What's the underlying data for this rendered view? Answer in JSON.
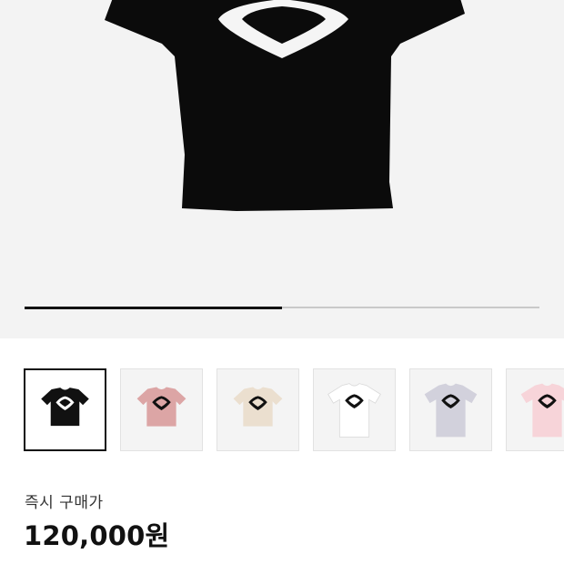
{
  "gallery": {
    "progress": 0.5,
    "main_image": {
      "icon": "black-cropped-tshirt-image",
      "shirt_color": "#0b0b0b",
      "logo_color": "#f5f5f5"
    }
  },
  "thumbnails": [
    {
      "icon": "black-tshirt-thumbnail",
      "color": "#111111",
      "logo": "#ffffff",
      "cropped": true,
      "selected": true
    },
    {
      "icon": "pink-tshirt-thumbnail",
      "color": "#dca5a5",
      "logo": "#111111",
      "cropped": true,
      "selected": false
    },
    {
      "icon": "beige-tshirt-thumbnail",
      "color": "#ebdfcf",
      "logo": "#111111",
      "cropped": true,
      "selected": false
    },
    {
      "icon": "white-tshirt-thumbnail",
      "color": "#ffffff",
      "logo": "#111111",
      "cropped": false,
      "selected": false
    },
    {
      "icon": "grey-tshirt-thumbnail",
      "color": "#d2d1dc",
      "logo": "#111111",
      "cropped": false,
      "selected": false
    },
    {
      "icon": "light-pink-tshirt-thumbnail",
      "color": "#f7d4d9",
      "logo": "#111111",
      "cropped": false,
      "selected": false
    }
  ],
  "price": {
    "label": "즉시 구매가",
    "value": "120,000원"
  }
}
